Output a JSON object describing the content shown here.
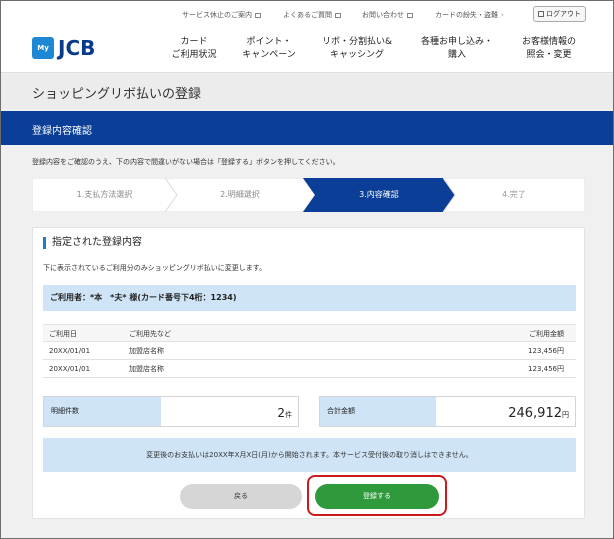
{
  "util_links": [
    {
      "label": "サービス休止のご案内"
    },
    {
      "label": "よくあるご質問"
    },
    {
      "label": "お問い合わせ"
    },
    {
      "label": "カードの紛失・盗難"
    }
  ],
  "logout_label": "ログアウト",
  "logo": {
    "my": "My",
    "brand": "JCB"
  },
  "nav": [
    {
      "line1": "カード",
      "line2": "ご利用状況"
    },
    {
      "line1": "ポイント・",
      "line2": "キャンペーン"
    },
    {
      "line1": "リボ・分割払い&",
      "line2": "キャッシング"
    },
    {
      "line1": "各種お申し込み・",
      "line2": "購入"
    },
    {
      "line1": "お客様情報の",
      "line2": "照会・変更"
    }
  ],
  "page_title": "ショッピングリボ払いの登録",
  "section_header": "登録内容確認",
  "instruction": "登録内容をご確認のうえ、下の内容で間違いがない場合は「登録する」ボタンを押してください。",
  "steps": [
    {
      "label": "1.支払方法選択",
      "state": "done"
    },
    {
      "label": "2.明細選択",
      "state": "done"
    },
    {
      "label": "3.内容確認",
      "state": "current"
    },
    {
      "label": "4.完了",
      "state": "upcoming"
    }
  ],
  "colors": {
    "brand_navy": "#0a3e97",
    "light_blue": "#cfe4f7",
    "green": "#2f9a3b",
    "highlight_red": "#cc1a1a"
  },
  "registered": {
    "title": "指定された登録内容",
    "description": "下に表示されているご利用分のみショッピングリボ払いに変更します。",
    "user_line": "ご利用者：*本　*夫* 様(カード番号下4桁：1234)",
    "table": {
      "headers": [
        "ご利用日",
        "ご利用先など",
        "ご利用金額"
      ],
      "rows": [
        [
          "20XX/01/01",
          "加盟店名称",
          "123,456円"
        ],
        [
          "20XX/01/01",
          "加盟店名称",
          "123,456円"
        ]
      ]
    },
    "count": {
      "label": "明細件数",
      "value": "2",
      "unit": "件"
    },
    "total": {
      "label": "合計金額",
      "value": "246,912",
      "unit": "円"
    },
    "notice": "変更後のお支払いは20XX年X月X日(月)から開始されます。本サービス受付後の取り消しはできません。"
  },
  "buttons": {
    "back": "戻る",
    "register": "登録する"
  }
}
